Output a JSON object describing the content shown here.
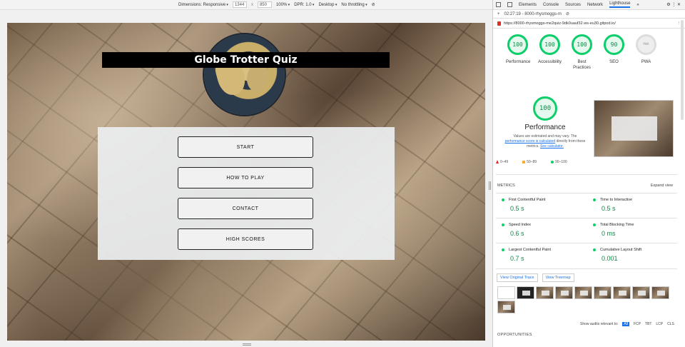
{
  "device_toolbar": {
    "dimensions": "Dimensions: Responsive",
    "width": "1344",
    "times": "x",
    "height": "850",
    "zoom": "100%",
    "dpr": "DPR: 1.0",
    "device": "Desktop",
    "throttling": "No throttling"
  },
  "page": {
    "title": "Globe Trotter Quiz",
    "buttons": [
      "START",
      "HOW TO PLAY",
      "CONTACT",
      "HIGH SCORES"
    ]
  },
  "devtools": {
    "tabs": [
      "Elements",
      "Console",
      "Sources",
      "Network",
      "Lighthouse",
      "»"
    ],
    "active_tab": "Lighthouse",
    "report_select": "02:27:19 - 8000-rhysmoggs-m",
    "url": "https://8000-rhysmoggs-me2quiz-9dk0uauf32.ws-eu30.gitpod.io/",
    "gauges": [
      {
        "score": "100",
        "label": "Performance"
      },
      {
        "score": "100",
        "label": "Accessibility"
      },
      {
        "score": "100",
        "label": "Best Practices"
      },
      {
        "score": "90",
        "label": "SEO"
      },
      {
        "score": "PWA",
        "label": "PWA"
      }
    ],
    "perf": {
      "score": "100",
      "title": "Performance",
      "note_a": "Values are estimated and may vary. The",
      "note_link": "performance score is calculated",
      "note_b": "directly from these metrics.",
      "calc_link": "See calculator."
    },
    "legend": [
      "0–49",
      "50–89",
      "90–100"
    ],
    "metrics_title": "METRICS",
    "expand": "Expand view",
    "metrics": [
      {
        "label": "First Contentful Paint",
        "value": "0.5 s"
      },
      {
        "label": "Time to Interactive",
        "value": "0.5 s"
      },
      {
        "label": "Speed Index",
        "value": "0.6 s"
      },
      {
        "label": "Total Blocking Time",
        "value": "0 ms"
      },
      {
        "label": "Largest Contentful Paint",
        "value": "0.7 s"
      },
      {
        "label": "Cumulative Layout Shift",
        "value": "0.001"
      }
    ],
    "buttons": [
      "View Original Trace",
      "View Treemap"
    ],
    "audits_label": "Show audits relevant to:",
    "audit_chips": [
      "All",
      "FCP",
      "TBT",
      "LCP",
      "CLS"
    ],
    "opportunities": "OPPORTUNITIES"
  },
  "colors": {
    "pass": "#0cce6b",
    "link": "#1a73e8"
  }
}
